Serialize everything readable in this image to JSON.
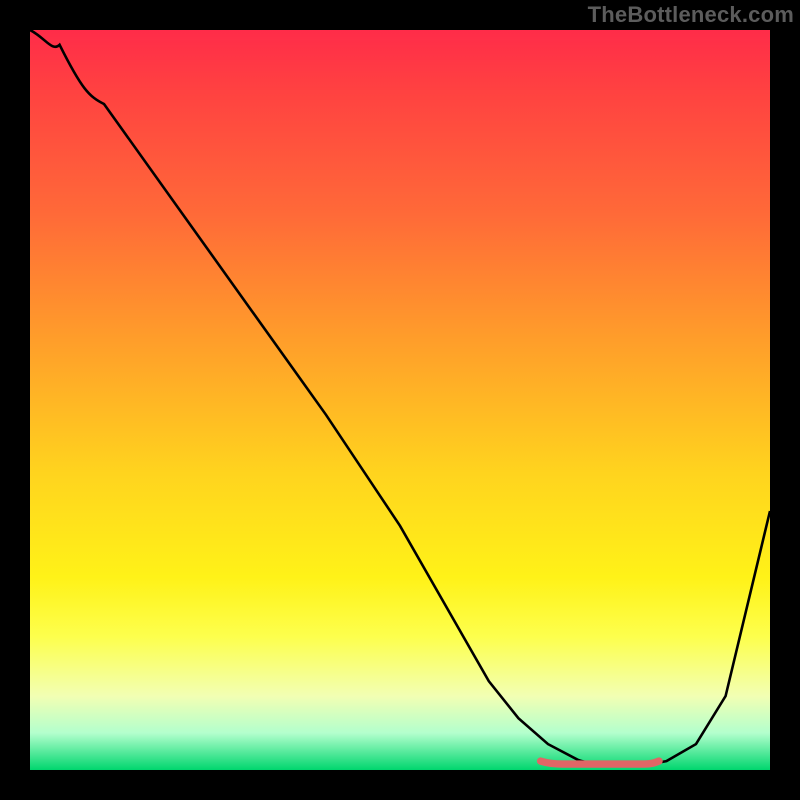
{
  "watermark": "TheBottleneck.com",
  "colors": {
    "background": "#000000",
    "watermark": "#5c5c5c",
    "curve": "#000000",
    "flat_zone": "#e06666",
    "gradient_top": "#ff2c49",
    "gradient_bottom": "#00d66e"
  },
  "chart_data": {
    "type": "line",
    "title": "",
    "xlabel": "",
    "ylabel": "",
    "xlim": [
      0,
      100
    ],
    "ylim": [
      0,
      100
    ],
    "x": [
      0,
      4,
      10,
      20,
      30,
      40,
      50,
      58,
      62,
      66,
      70,
      74,
      78,
      82,
      86,
      90,
      94,
      100
    ],
    "values": [
      100,
      98,
      90,
      76,
      62,
      48,
      33,
      19,
      12,
      7,
      3.5,
      1.4,
      0.7,
      0.7,
      1.2,
      3.5,
      10,
      35
    ],
    "flat_zone": {
      "x_start": 69,
      "x_end": 85,
      "y": 0.9
    },
    "legend": [],
    "grid": false
  }
}
